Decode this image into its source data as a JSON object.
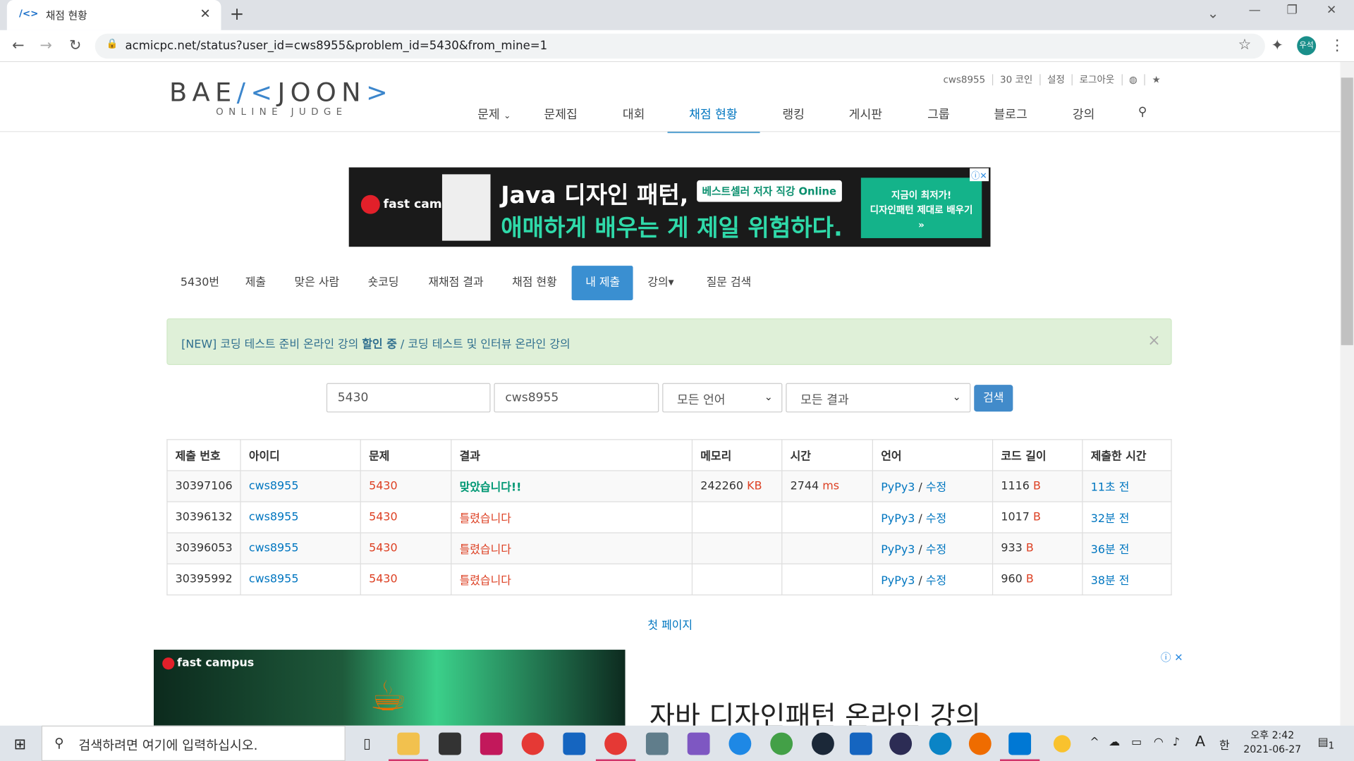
{
  "browser": {
    "tab_title": "채점 현황",
    "tab_favicon": "/<>",
    "url": "acmicpc.net/status?user_id=cws8955&problem_id=5430&from_mine=1",
    "profile": "우석"
  },
  "site": {
    "logo_text": "BAEKJOON",
    "logo_sub": "ONLINE JUDGE",
    "top_links": [
      "cws8955",
      "30 코인",
      "설정",
      "로그아웃"
    ],
    "nav": [
      "문제",
      "문제집",
      "대회",
      "채점 현황",
      "랭킹",
      "게시판",
      "그룹",
      "블로그",
      "강의"
    ],
    "nav_active": "채점 현황"
  },
  "ad_top": {
    "brand": "fast campus",
    "line1": "Java 디자인 패턴,",
    "pill": "베스트셀러 저자 직강 Online",
    "line2": "애매하게 배우는 게 제일 위험하다.",
    "cta1": "지금이 최저가!",
    "cta2": "디자인패턴 제대로 배우기",
    "cta3": "»"
  },
  "subnav": [
    "5430번",
    "제출",
    "맞은 사람",
    "숏코딩",
    "재채점 결과",
    "채점 현황",
    "내 제출",
    "강의▾",
    "질문 검색"
  ],
  "subnav_active": "내 제출",
  "alert": {
    "pre": "[NEW] 코딩 테스트 준비 온라인 강의 ",
    "bold": "할인 중",
    "post": " / 코딩 테스트 및 인터뷰 온라인 강의"
  },
  "search": {
    "problem": "5430",
    "user": "cws8955",
    "language": "모든 언어",
    "result": "모든 결과",
    "button": "검색"
  },
  "table": {
    "headers": [
      "제출 번호",
      "아이디",
      "문제",
      "결과",
      "메모리",
      "시간",
      "언어",
      "코드 길이",
      "제출한 시간"
    ],
    "rows": [
      {
        "id": "30397106",
        "user": "cws8955",
        "problem": "5430",
        "result": "맞았습니다!!",
        "memory": "242260",
        "memory_unit": "KB",
        "time": "2744",
        "time_unit": "ms",
        "lang": "PyPy3",
        "edit": "수정",
        "length": "1116",
        "length_unit": "B",
        "submitted": "11초 전"
      },
      {
        "id": "30396132",
        "user": "cws8955",
        "problem": "5430",
        "result": "틀렸습니다",
        "memory": "",
        "memory_unit": "",
        "time": "",
        "time_unit": "",
        "lang": "PyPy3",
        "edit": "수정",
        "length": "1017",
        "length_unit": "B",
        "submitted": "32분 전"
      },
      {
        "id": "30396053",
        "user": "cws8955",
        "problem": "5430",
        "result": "틀렸습니다",
        "memory": "",
        "memory_unit": "",
        "time": "",
        "time_unit": "",
        "lang": "PyPy3",
        "edit": "수정",
        "length": "933",
        "length_unit": "B",
        "submitted": "36분 전"
      },
      {
        "id": "30395992",
        "user": "cws8955",
        "problem": "5430",
        "result": "틀렸습니다",
        "memory": "",
        "memory_unit": "",
        "time": "",
        "time_unit": "",
        "lang": "PyPy3",
        "edit": "수정",
        "length": "960",
        "length_unit": "B",
        "submitted": "38분 전"
      }
    ]
  },
  "first_page": "첫 페이지",
  "ad_bottom": {
    "brand": "fast campus",
    "headline": "자바 디자인패턴 온라인 강의"
  },
  "taskbar": {
    "search_placeholder": "검색하려면 여기에 입력하십시오.",
    "ime": "한",
    "time": "오후 2:42",
    "date": "2021-06-27",
    "notif": "1"
  }
}
